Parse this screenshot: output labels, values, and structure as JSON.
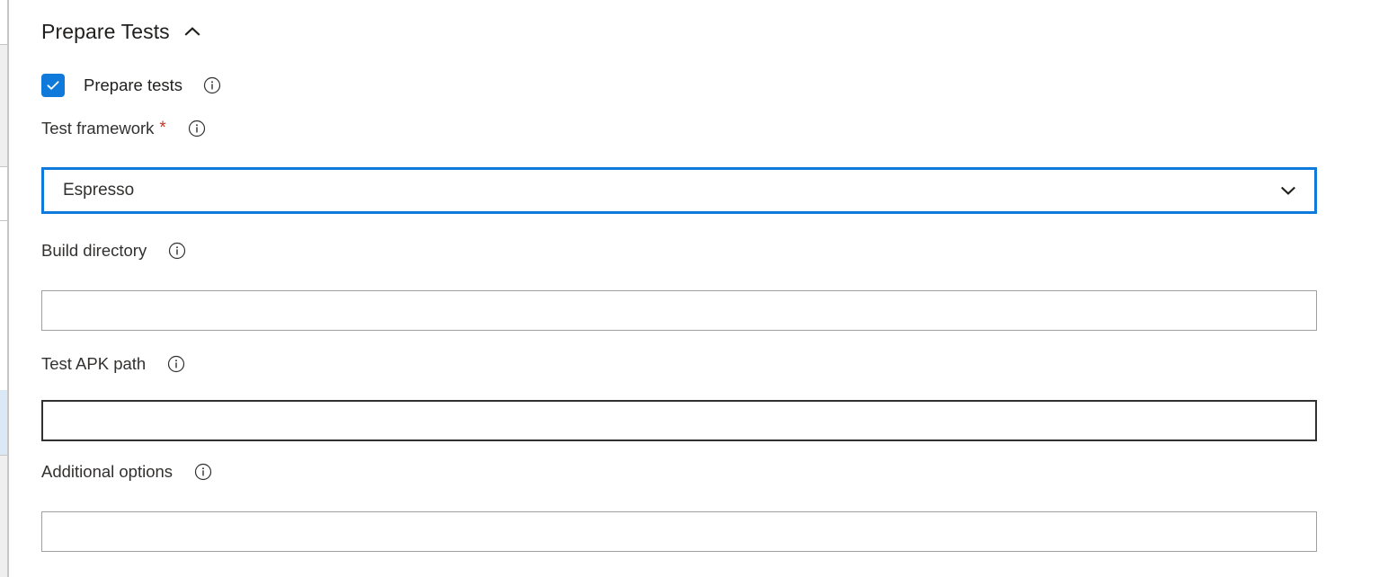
{
  "section": {
    "title": "Prepare Tests",
    "collapse_icon": "chevron-up-icon",
    "expanded": true
  },
  "checkbox": {
    "label": "Prepare tests",
    "checked": true,
    "info_icon": "info-icon",
    "color": "#0f7ad9"
  },
  "fields": [
    {
      "id": "test-framework",
      "label": "Test framework",
      "required": true,
      "required_marker": "*",
      "info_icon": "info-icon",
      "control": "dropdown",
      "value": "Espresso",
      "placeholder": "",
      "caret_icon": "chevron-down-icon",
      "state": "focused",
      "border_color": "#0f7ad9"
    },
    {
      "id": "build-directory",
      "label": "Build directory",
      "required": false,
      "required_marker": "",
      "info_icon": "info-icon",
      "control": "textbox",
      "value": "",
      "placeholder": "",
      "state": "rest",
      "border_color": "#a19f9d"
    },
    {
      "id": "test-apk-path",
      "label": "Test APK path",
      "required": false,
      "required_marker": "",
      "info_icon": "info-icon",
      "control": "textbox",
      "value": "",
      "placeholder": "",
      "state": "hover",
      "border_color": "#323130"
    },
    {
      "id": "additional-options",
      "label": "Additional options",
      "required": false,
      "required_marker": "",
      "info_icon": "info-icon",
      "control": "textbox",
      "value": "",
      "placeholder": "",
      "state": "rest",
      "border_color": "#a19f9d"
    }
  ],
  "colors": {
    "accent": "#0f7ad9",
    "required": "#c0392b",
    "border_rest": "#a19f9d",
    "border_hover": "#323130",
    "text": "#323130",
    "rail_line": "#c8c6c4",
    "rail_gray": "#f0efef",
    "rail_blue": "#dbe8f5"
  }
}
